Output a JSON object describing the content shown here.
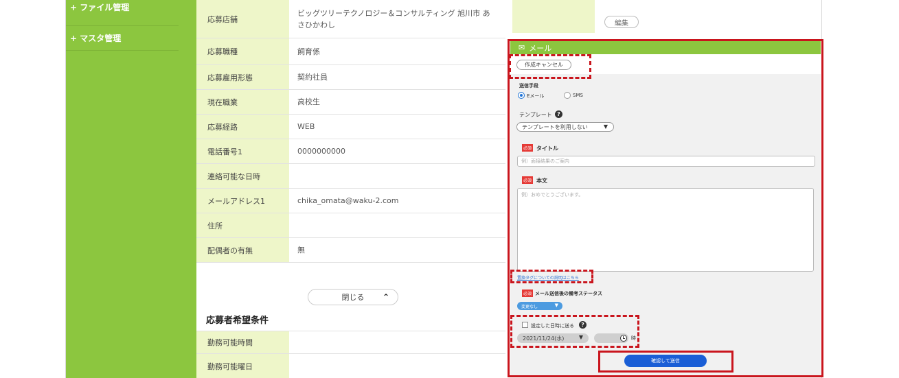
{
  "sidebar": {
    "items": [
      {
        "label": "+ ファイル管理"
      },
      {
        "label": "+ マスタ管理"
      }
    ]
  },
  "applicant": {
    "rows": [
      {
        "label": "応募店舗",
        "value": "ビッグツリーテクノロジー＆コンサルティング 旭川市 あさひかわし"
      },
      {
        "label": "応募職種",
        "value": "飼育係"
      },
      {
        "label": "応募雇用形態",
        "value": "契約社員"
      },
      {
        "label": "現在職業",
        "value": "高校生"
      },
      {
        "label": "応募経路",
        "value": "WEB"
      },
      {
        "label": "電話番号1",
        "value": "0000000000"
      },
      {
        "label": "連絡可能な日時",
        "value": ""
      },
      {
        "label": "メールアドレス1",
        "value": "chika_omata@waku-2.com"
      },
      {
        "label": "住所",
        "value": ""
      },
      {
        "label": "配偶者の有無",
        "value": "無"
      }
    ],
    "close_label": "閉じる",
    "close_icon": "chevron-up-icon"
  },
  "preferences": {
    "title": "応募者希望条件",
    "rows": [
      {
        "label": "勤務可能時間",
        "value": ""
      },
      {
        "label": "勤務可能曜日",
        "value": ""
      }
    ]
  },
  "top_right": {
    "edit_label": "編集"
  },
  "mail": {
    "header": "メール",
    "header_icon": "envelope-icon",
    "cancel_label": "作成キャンセル",
    "send_method_label": "送信手段",
    "method_email": "Eメール",
    "method_sms": "SMS",
    "selected_method": "Eメール",
    "template_label": "テンプレート",
    "template_value": "テンプレートを利用しない",
    "required_badge": "必須",
    "title_label": "タイトル",
    "title_placeholder": "例）面接結果のご案内",
    "body_label": "本文",
    "body_placeholder": "例）おめでとうございます。",
    "tag_link": "置換タグについての説明はこちら",
    "status_label": "メール送信後の備考ステータス",
    "status_value": "変更なし",
    "schedule_label": "設定した日時に送る",
    "schedule_checked": false,
    "date_value": "2021/11/24(水)",
    "time_suffix": "時",
    "send_label": "確認して送信"
  },
  "colors": {
    "sidebar_green": "#8cc63f",
    "label_bg": "#eef6c9",
    "highlight_red": "#c9151d",
    "primary_blue": "#1a5ed6",
    "status_blue": "#4d9be0",
    "required_red": "#e53935"
  }
}
